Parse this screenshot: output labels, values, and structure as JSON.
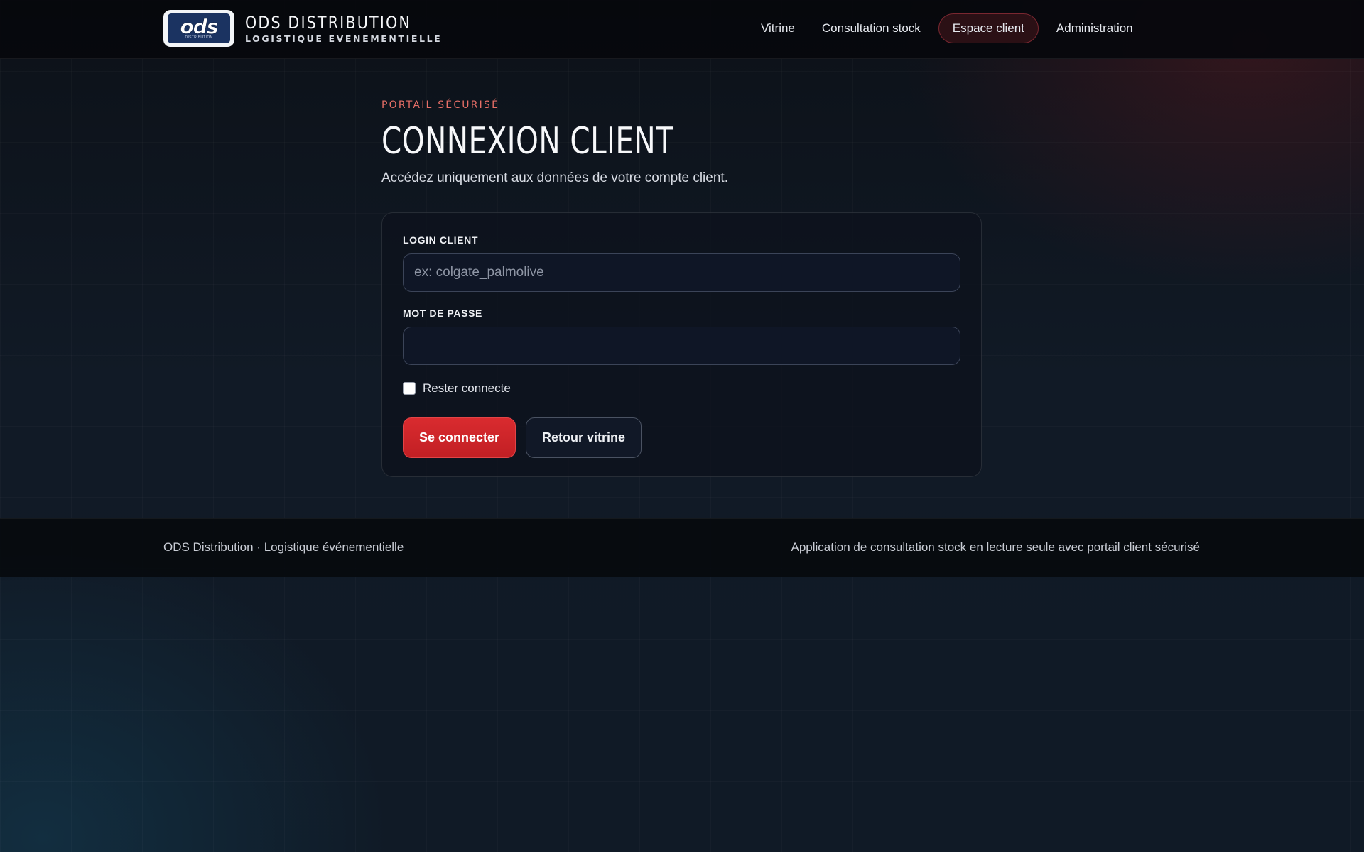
{
  "header": {
    "logo": {
      "text": "ods",
      "subtext": "DISTRIBUTION",
      "icon": "ods-logo"
    },
    "brand_title": "ODS DISTRIBUTION",
    "brand_subtitle": "LOGISTIQUE EVENEMENTIELLE",
    "nav": [
      {
        "label": "Vitrine",
        "active": false
      },
      {
        "label": "Consultation stock",
        "active": false
      },
      {
        "label": "Espace client",
        "active": true
      },
      {
        "label": "Administration",
        "active": false
      }
    ]
  },
  "main": {
    "eyebrow": "PORTAIL SÉCURISÉ",
    "title": "CONNEXION CLIENT",
    "description": "Accédez uniquement aux données de votre compte client."
  },
  "form": {
    "login_label": "LOGIN CLIENT",
    "login_placeholder": "ex: colgate_palmolive",
    "login_value": "",
    "password_label": "MOT DE PASSE",
    "password_value": "",
    "remember_label": "Rester connecte",
    "remember_checked": false,
    "submit_label": "Se connecter",
    "back_label": "Retour vitrine"
  },
  "footer": {
    "left": "ODS Distribution · Logistique événementielle",
    "right": "Application de consultation stock en lecture seule avec portail client sécurisé"
  },
  "colors": {
    "accent": "#d92b2f",
    "eyebrow": "#e86f67",
    "active_nav_bg": "#2b1015",
    "active_nav_border": "#7a2730",
    "background": "#111a26"
  }
}
